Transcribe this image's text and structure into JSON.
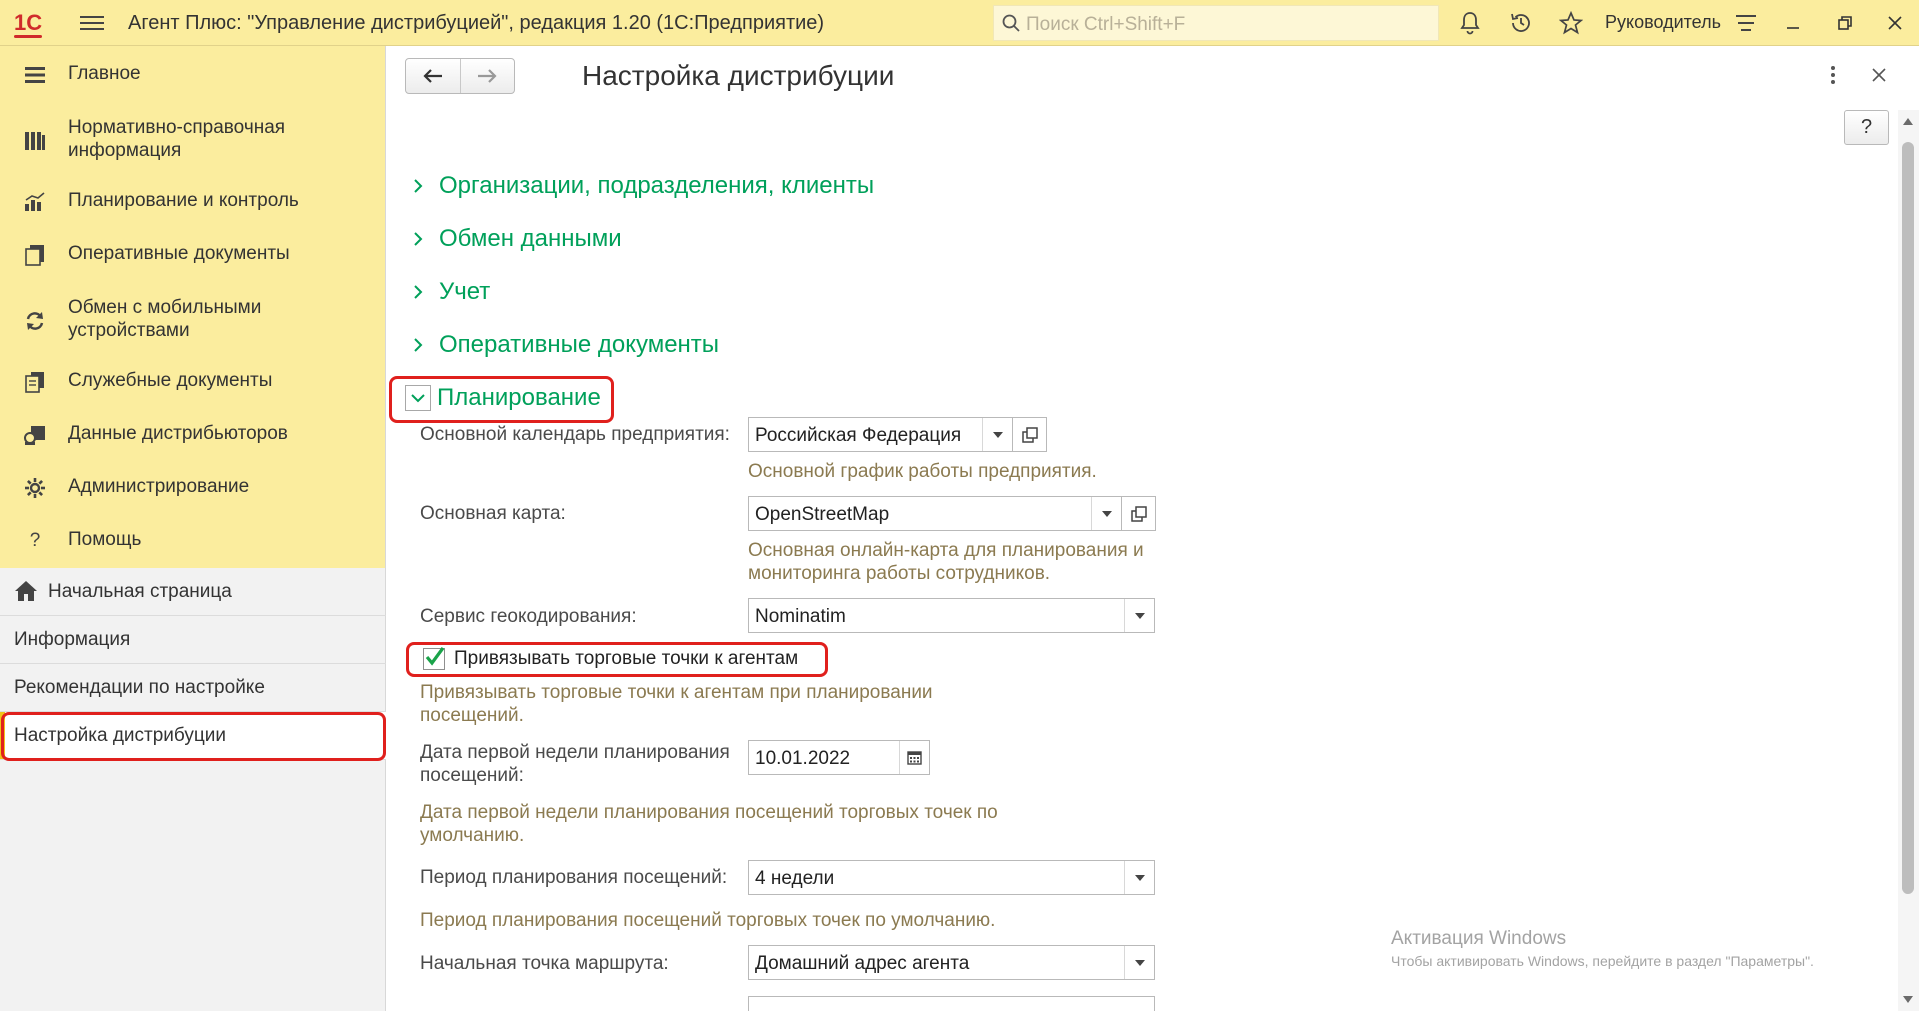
{
  "titlebar": {
    "logo": "1С",
    "app_title": "Агент Плюс: \"Управление дистрибуцией\", редакция 1.20  (1С:Предприятие)",
    "search_placeholder": "Поиск Ctrl+Shift+F",
    "user": "Руководитель"
  },
  "sidebar": {
    "sections": [
      {
        "label": "Главное",
        "icon": "list-icon"
      },
      {
        "label": "Нормативно-справочная информация",
        "icon": "reference-books-icon"
      },
      {
        "label": "Планирование и контроль",
        "icon": "bar-chart-icon"
      },
      {
        "label": "Оперативные документы",
        "icon": "documents-icon"
      },
      {
        "label": "Обмен с мобильными устройствами",
        "icon": "sync-icon"
      },
      {
        "label": "Служебные документы",
        "icon": "service-docs-icon"
      },
      {
        "label": "Данные дистрибьюторов",
        "icon": "distributors-icon"
      },
      {
        "label": "Администрирование",
        "icon": "gear-icon"
      },
      {
        "label": "Помощь",
        "icon": "help-icon"
      }
    ],
    "nav": [
      {
        "label": "Начальная страница",
        "icon": "home-icon"
      },
      {
        "label": "Информация"
      },
      {
        "label": "Рекомендации по настройке"
      },
      {
        "label": "Настройка дистрибуции",
        "active": true
      }
    ]
  },
  "main": {
    "title": "Настройка дистрибуции",
    "help_label": "?",
    "groups": [
      {
        "label": "Организации, подразделения, клиенты",
        "expanded": false
      },
      {
        "label": "Обмен данными",
        "expanded": false
      },
      {
        "label": "Учет",
        "expanded": false
      },
      {
        "label": "Оперативные документы",
        "expanded": false
      },
      {
        "label": "Планирование",
        "expanded": true
      }
    ],
    "planning": {
      "calendar_label": "Основной календарь предприятия:",
      "calendar_value": "Российская Федерация",
      "calendar_hint": "Основной график работы предприятия.",
      "map_label": "Основная карта:",
      "map_value": "OpenStreetMap",
      "map_hint_1": "Основная онлайн-карта для планирования и",
      "map_hint_2": "мониторинга работы сотрудников.",
      "geocoding_label": "Сервис геокодирования:",
      "geocoding_value": "Nominatim",
      "bind_outlets_label": "Привязывать торговые точки к агентам",
      "bind_outlets_checked": true,
      "bind_outlets_hint_1": "Привязывать торговые точки к агентам при планировании",
      "bind_outlets_hint_2": "посещений.",
      "first_week_label_1": "Дата первой недели планирования",
      "first_week_label_2": "посещений:",
      "first_week_value": "10.01.2022",
      "first_week_hint_1": "Дата первой недели планирования посещений торговых точек по",
      "first_week_hint_2": "умолчанию.",
      "period_label": "Период планирования посещений:",
      "period_value": "4 недели",
      "period_hint": "Период планирования посещений торговых точек по умолчанию.",
      "start_point_label": "Начальная точка маршрута:",
      "start_point_value": "Домашний адрес агента"
    }
  },
  "watermark": {
    "title": "Активация Windows",
    "subtitle": "Чтобы активировать Windows, перейдите в раздел \"Параметры\"."
  },
  "colors": {
    "titlebar_bg": "#fbed9e",
    "group_green": "#00a05a",
    "hint_brown": "#8b7a50",
    "highlight_red": "#e0201d",
    "checkbox_green": "#1aa34a"
  }
}
